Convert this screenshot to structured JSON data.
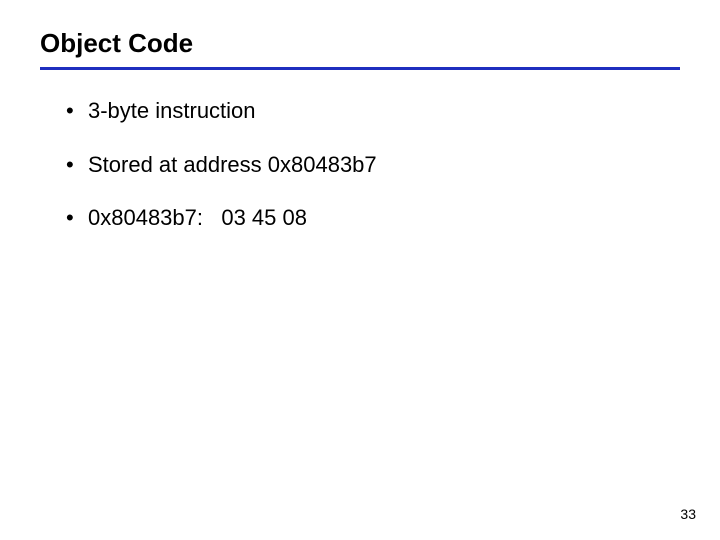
{
  "title": "Object Code",
  "bullets": {
    "b1": "3-byte instruction",
    "b2": "Stored at address 0x80483b7",
    "b3_label": "0x80483b7:   ",
    "b3_bytes": "03 45 08"
  },
  "page_number": "33",
  "colors": {
    "divider": "#1f2fbf"
  }
}
